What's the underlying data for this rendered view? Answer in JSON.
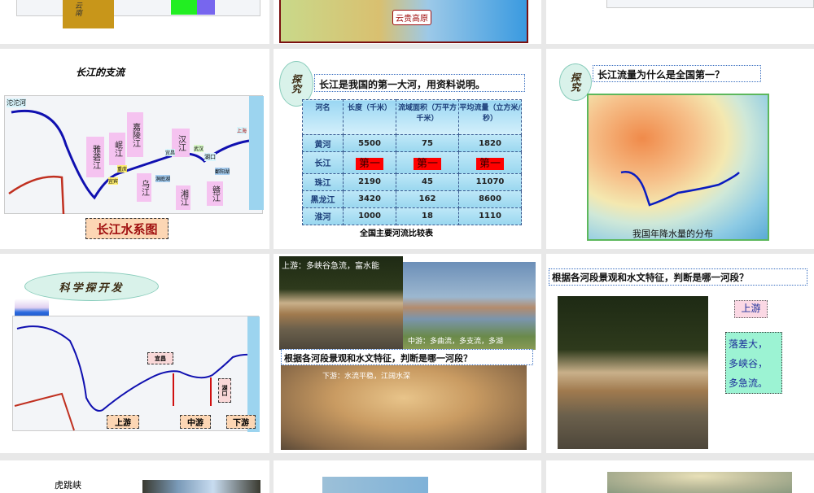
{
  "slides": {
    "s1": {
      "province_label": "云南"
    },
    "s2": {
      "map_label": "云贵高原"
    },
    "s4": {
      "title": "长江的支流",
      "map_labels": [
        "沱沱河",
        "雅砻江",
        "岷江",
        "嘉陵江",
        "乌江",
        "汉江",
        "湘江",
        "赣江",
        "重庆",
        "宜宾",
        "宜昌",
        "武汉",
        "湖口",
        "上海",
        "洞庭湖",
        "鄱阳湖"
      ],
      "caption": "长江水系图"
    },
    "s5": {
      "badge": "探究",
      "question": "长江是我国的第一大河，用资料说明。",
      "table": {
        "headers": [
          "河名",
          "长度（千米）",
          "流域面积（万平方千米）",
          "平均流量（立方米/秒）"
        ],
        "rows": [
          [
            "黄河",
            "5500",
            "75",
            "1820"
          ],
          [
            "长江",
            "第一",
            "第一",
            "第一"
          ],
          [
            "珠江",
            "2190",
            "45",
            "11070"
          ],
          [
            "黑龙江",
            "3420",
            "162",
            "8600"
          ],
          [
            "淮河",
            "1000",
            "18",
            "1110"
          ]
        ]
      },
      "caption": "全国主要河流比较表"
    },
    "s6": {
      "badge": "探究",
      "question": "长江流量为什么是全国第一？",
      "caption": "我国年降水量的分布"
    },
    "s7": {
      "banner": "科学探开发",
      "labels": [
        "宜昌",
        "湖口",
        "上游",
        "中游",
        "下游"
      ]
    },
    "s8": {
      "upper": "上游：多峡谷急流，富水能",
      "middle": "中游：多曲流，多支流，多湖",
      "question": "根据各河段景观和水文特征，判断是哪一河段？",
      "lower": "下游：水流平稳，江阔水深"
    },
    "s9": {
      "question": "根据各河段景观和水文特征，判断是哪一河段？",
      "answer": "上游",
      "features": [
        "落差大，",
        "多峡谷，",
        "多急流。"
      ]
    },
    "s10": {
      "title": "虎跳峡"
    }
  }
}
